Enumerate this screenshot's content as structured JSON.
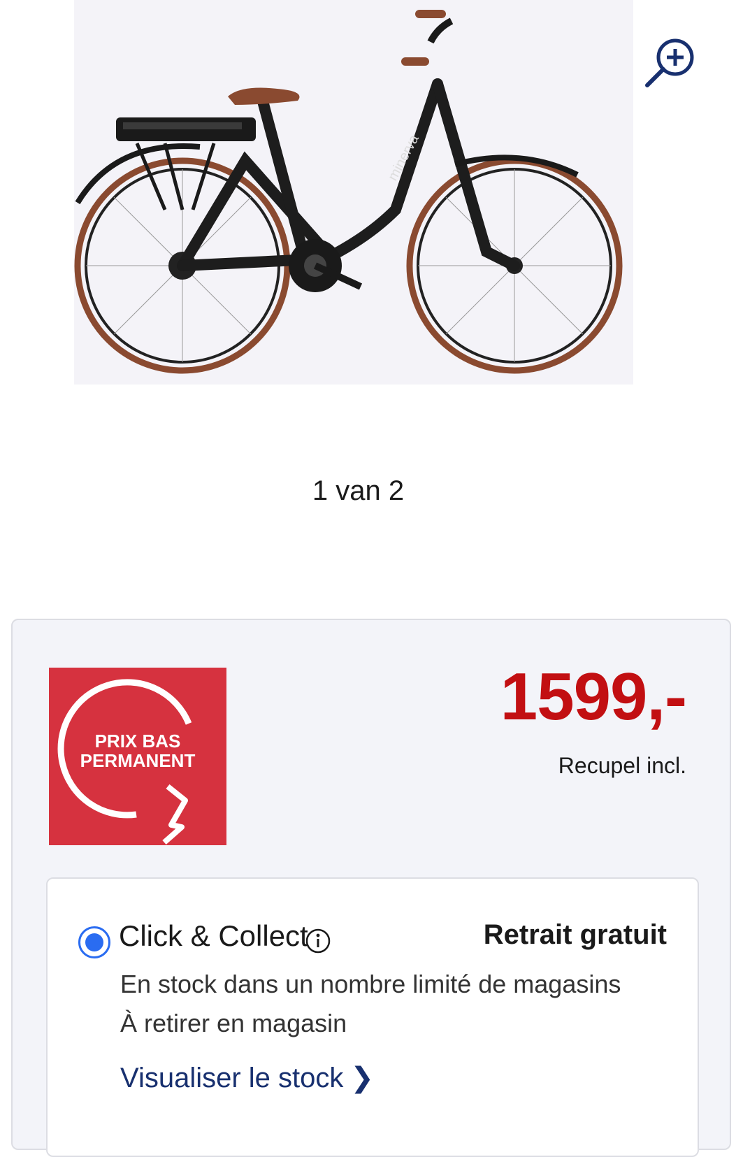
{
  "gallery": {
    "counter": "1 van 2",
    "image_icon": "electric-bike-product-image",
    "zoom_icon": "zoom-in-icon",
    "brand_on_frame": "minerva"
  },
  "pricing": {
    "badge_line1": "PRIX BAS",
    "badge_line2": "PERMANENT",
    "badge_color": "#d6323f",
    "price": "1599,-",
    "price_color": "#c20f12",
    "recupel": "Recupel incl."
  },
  "delivery": {
    "option_label": "Click & Collect",
    "option_selected": true,
    "info_icon": "info-icon",
    "retrait_label": "Retrait gratuit",
    "stock_line1": "En stock dans un nombre limité de magasins",
    "stock_line2": "À retirer en magasin",
    "stock_link": "Visualiser le stock",
    "link_color": "#18306f",
    "radio_color": "#2a6cf1"
  }
}
